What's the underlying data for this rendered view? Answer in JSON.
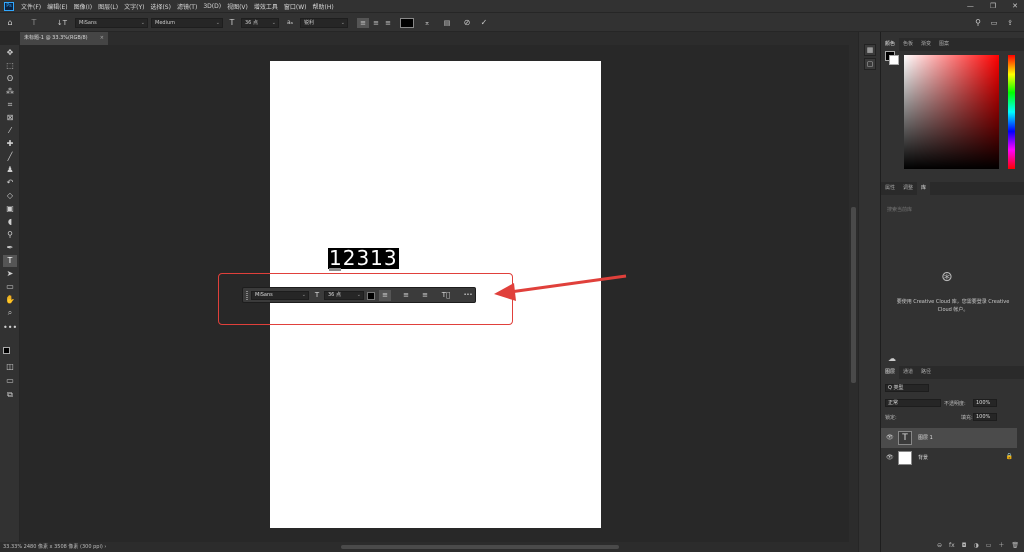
{
  "menubar": {
    "logo": "Ps",
    "items": [
      "文件(F)",
      "编辑(E)",
      "图像(I)",
      "图层(L)",
      "文字(Y)",
      "选择(S)",
      "滤镜(T)",
      "3D(D)",
      "视图(V)",
      "增效工具",
      "窗口(W)",
      "帮助(H)"
    ],
    "window_controls": [
      "—",
      "❐",
      "✕"
    ]
  },
  "options": {
    "font_family": "MiSans",
    "font_style": "Medium",
    "font_size": "36 点",
    "aa_label": "aₐ",
    "antialias": "锐利"
  },
  "document_tab": {
    "title": "未标题-1 @ 33.3%(RGB/8)",
    "close": "×"
  },
  "canvas": {
    "text": "12313"
  },
  "context_bar": {
    "font_family": "MiSans",
    "font_size": "36 点",
    "color": "#000000",
    "more": "•••"
  },
  "statusbar": {
    "text": "33.33%  2480 像素 x 3508 像素 (300 ppi)   ›"
  },
  "panels": {
    "color_tabs": [
      "颜色",
      "色板",
      "渐变",
      "图案"
    ],
    "props_tabs": [
      "属性",
      "调整",
      "库"
    ],
    "library_search": "搜索当前库",
    "cc_message": "要使用 Creative Cloud 库，您需要登录 Creative Cloud 帐户。",
    "layers_tabs": [
      "图层",
      "通道",
      "路径"
    ],
    "kind_filter": "Q 类型",
    "blend_mode": "正常",
    "opacity_label": "不透明度:",
    "opacity_value": "100%",
    "lock_label": "锁定:",
    "fill_label": "填充:",
    "fill_value": "100%",
    "layers": [
      {
        "name": "图层 1",
        "type": "text"
      },
      {
        "name": "背景",
        "type": "bg"
      }
    ],
    "footer_icons": [
      "⊖",
      "fx",
      "◘",
      "◑",
      "▭",
      "＋",
      "🗑"
    ]
  },
  "colors": {
    "highlight": "#e0403b",
    "foreground": "#000000",
    "background": "#ffffff"
  }
}
